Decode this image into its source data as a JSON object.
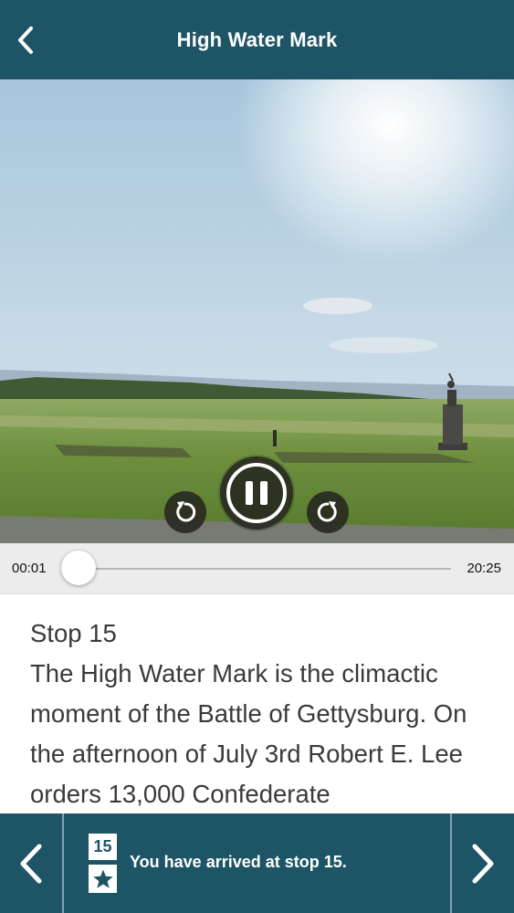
{
  "header": {
    "title": "High Water Mark",
    "back_icon": "chevron-left-icon"
  },
  "player": {
    "current_time": "00:01",
    "total_time": "20:25",
    "progress_fraction": 0.001,
    "pause_icon": "pause-icon",
    "rewind_icon": "rewind-icon",
    "forward_icon": "forward-icon"
  },
  "content": {
    "stop_heading": "Stop 15",
    "description": "The High Water Mark is the climactic moment of the Battle of Gettysburg. On the afternoon of July 3rd Robert E. Lee orders 13,000 Confederate"
  },
  "footer": {
    "stop_number": "15",
    "status_text": "You have arrived at stop 15.",
    "prev_icon": "chevron-left-icon",
    "next_icon": "chevron-right-icon",
    "star_icon": "star-icon"
  },
  "colors": {
    "bar": "#1e5566",
    "divider": "#7fa4b0"
  }
}
